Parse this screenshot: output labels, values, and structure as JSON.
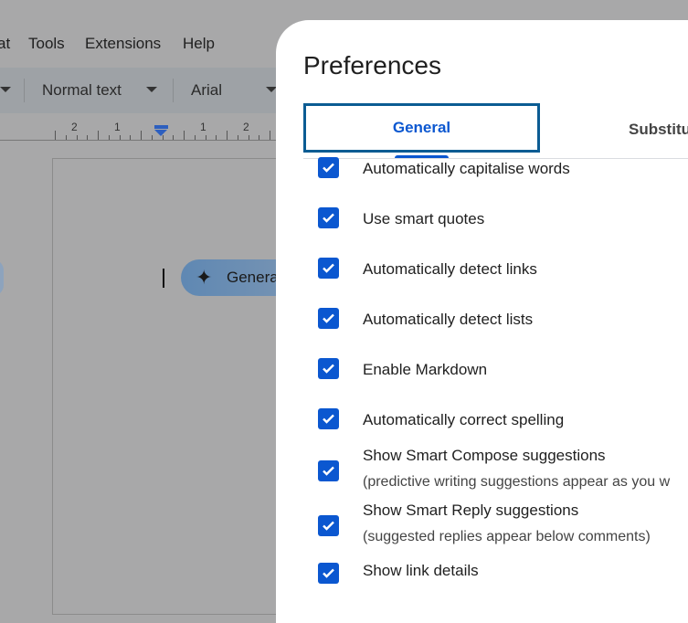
{
  "menu": {
    "items": [
      "at",
      "Tools",
      "Extensions",
      "Help"
    ]
  },
  "toolbar": {
    "style": "Normal text",
    "font": "Arial"
  },
  "ruler": {
    "labels": [
      "2",
      "1",
      "1",
      "2"
    ]
  },
  "document": {
    "generate_chip": "Genera"
  },
  "dialog": {
    "title": "Preferences",
    "tabs": [
      {
        "label": "General",
        "selected": true
      },
      {
        "label": "Substitu",
        "selected": false
      }
    ],
    "options": [
      {
        "label": "Automatically capitalise words",
        "checked": true
      },
      {
        "label": "Use smart quotes",
        "checked": true
      },
      {
        "label": "Automatically detect links",
        "checked": true
      },
      {
        "label": "Automatically detect lists",
        "checked": true
      },
      {
        "label": "Enable Markdown",
        "checked": true
      },
      {
        "label": "Automatically correct spelling",
        "checked": true
      },
      {
        "label": "Show Smart Compose suggestions",
        "sub": "(predictive writing suggestions appear as you w",
        "checked": true
      },
      {
        "label": "Show Smart Reply suggestions",
        "sub": "(suggested replies appear below comments)",
        "checked": true
      },
      {
        "label": "Show link details",
        "checked": true
      }
    ]
  },
  "colors": {
    "accent": "#0b57d0",
    "focus_ring": "#0b5c93"
  }
}
